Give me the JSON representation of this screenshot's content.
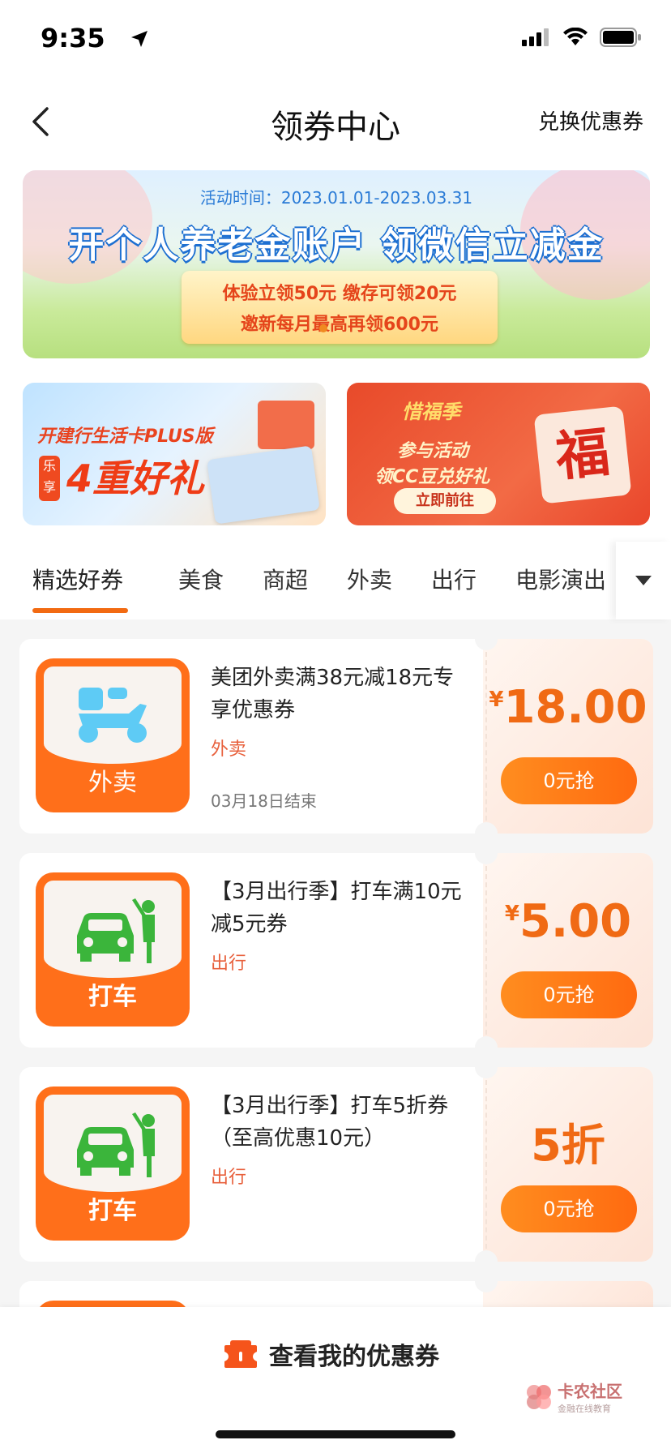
{
  "status_bar": {
    "time": "9:35"
  },
  "nav": {
    "title": "领券中心",
    "right_link": "兑换优惠券"
  },
  "banner_main": {
    "time": "活动时间：2023.01.01-2023.03.31",
    "headline": "开个人养老金账户  领微信立减金",
    "line1": "体验立领50元 缴存可领20元",
    "line2": "邀新每月最高再领600元"
  },
  "banner_left": {
    "line1": "开建行生活卡PLUS版",
    "tag": "乐享",
    "big": "4重好礼"
  },
  "banner_right": {
    "logo": "惜福季",
    "line1": "参与活动",
    "line2": "领CC豆兑好礼",
    "button": "立即前往",
    "fu": "福"
  },
  "tabs": [
    "精选好券",
    "美食",
    "商超",
    "外卖",
    "出行",
    "电影演出"
  ],
  "coupons": [
    {
      "icon_label": "外卖",
      "title": "美团外卖满38元减18元专享优惠券",
      "category": "外卖",
      "end": "03月18日结束",
      "symbol": "¥",
      "amount": "18.00",
      "button": "0元抢"
    },
    {
      "icon_label": "打车",
      "title": "【3月出行季】打车满10元减5元券",
      "category": "出行",
      "end": "",
      "symbol": "¥",
      "amount": "5.00",
      "button": "0元抢"
    },
    {
      "icon_label": "打车",
      "title": "【3月出行季】打车5折券（至高优惠10元）",
      "category": "出行",
      "end": "",
      "symbol": "",
      "amount": "5折",
      "button": "0元抢"
    }
  ],
  "bottom": {
    "link": "查看我的优惠券"
  },
  "watermark": {
    "main": "卡农社区",
    "sub": "金融在线教育"
  },
  "colors": {
    "accent": "#f26a12",
    "category": "#e8603c"
  }
}
